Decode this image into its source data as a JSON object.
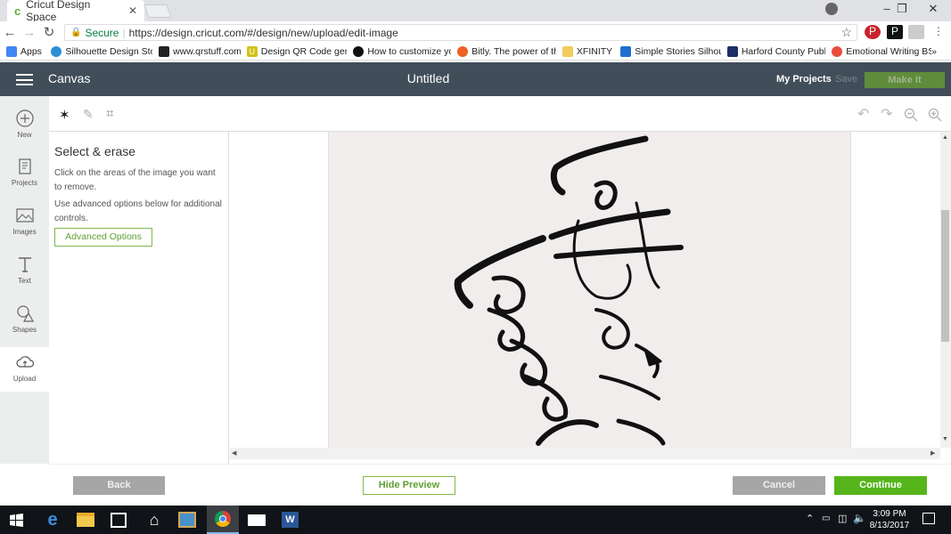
{
  "browser": {
    "tab_title": "Cricut Design Space",
    "tab_close": "✕",
    "secure_label": "Secure",
    "url": "https://design.cricut.com/#/design/new/upload/edit-image",
    "window_controls": [
      "–",
      "❐",
      "✕"
    ]
  },
  "bookmarks": [
    {
      "label": "Apps",
      "icon": "apps-grid-icon",
      "color": "#4285f4"
    },
    {
      "label": "Silhouette Design Sto",
      "icon": "silhouette-icon",
      "color": "#2b8fd6"
    },
    {
      "label": "www.qrstuff.com",
      "icon": "qr-icon",
      "color": "#222222"
    },
    {
      "label": "Design QR Code gen",
      "icon": "u-icon",
      "color": "#d4c21a"
    },
    {
      "label": "How to customize yo",
      "icon": "dot-icon",
      "color": "#111111"
    },
    {
      "label": "Bitly. The power of th",
      "icon": "bitly-icon",
      "color": "#ee6123"
    },
    {
      "label": "XFINITY",
      "icon": "folder-icon",
      "color": "#f2cc5c"
    },
    {
      "label": "Simple Stories Silhou",
      "icon": "dropbox-icon",
      "color": "#1f6fd1"
    },
    {
      "label": "Harford County Publi",
      "icon": "library-icon",
      "color": "#1c2f66"
    },
    {
      "label": "Emotional Writing BS",
      "icon": "eb-icon",
      "color": "#e94e3c"
    }
  ],
  "bookmarks_more": "»",
  "app": {
    "section": "Canvas",
    "title": "Untitled",
    "my_projects": "My Projects",
    "save": "Save",
    "make_it": "Make It"
  },
  "sidebar": {
    "items": [
      {
        "label": "New",
        "icon": "plus-circle-icon"
      },
      {
        "label": "Projects",
        "icon": "projects-icon"
      },
      {
        "label": "Images",
        "icon": "image-icon"
      },
      {
        "label": "Text",
        "icon": "text-icon"
      },
      {
        "label": "Shapes",
        "icon": "shapes-icon"
      },
      {
        "label": "Upload",
        "icon": "upload-cloud-icon"
      }
    ]
  },
  "panel": {
    "title": "Select & erase",
    "text1": "Click on the areas of the image you want to remove.",
    "text2": "Use advanced options below for additional controls.",
    "advanced": "Advanced Options"
  },
  "footer": {
    "back": "Back",
    "hide_preview": "Hide Preview",
    "cancel": "Cancel",
    "continue": "Continue"
  },
  "taskbar": {
    "time": "3:09 PM",
    "date": "8/13/2017"
  },
  "colors": {
    "header": "#414e5a",
    "green": "#55b51b",
    "gray_button": "#a6a6a6"
  }
}
